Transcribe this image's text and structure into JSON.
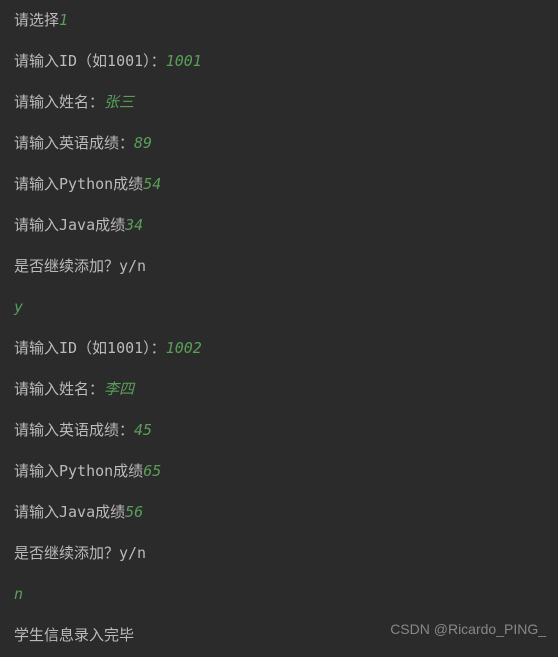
{
  "lines": [
    {
      "prompt": "请选择",
      "value": "1"
    },
    {
      "prompt": "请输入ID（如1001）：",
      "value": "1001"
    },
    {
      "prompt": "请输入姓名：",
      "value": "张三"
    },
    {
      "prompt": "请输入英语成绩：",
      "value": "89"
    },
    {
      "prompt": "请输入Python成绩",
      "value": "54"
    },
    {
      "prompt": "请输入Java成绩",
      "value": "34"
    },
    {
      "prompt": "是否继续添加？y/n",
      "value": ""
    },
    {
      "prompt": "",
      "value": "y"
    },
    {
      "prompt": "请输入ID（如1001）：",
      "value": "1002"
    },
    {
      "prompt": "请输入姓名：",
      "value": "李四"
    },
    {
      "prompt": "请输入英语成绩：",
      "value": "45"
    },
    {
      "prompt": "请输入Python成绩",
      "value": "65"
    },
    {
      "prompt": "请输入Java成绩",
      "value": "56"
    },
    {
      "prompt": "是否继续添加？y/n",
      "value": ""
    },
    {
      "prompt": "",
      "value": "n"
    },
    {
      "prompt": "学生信息录入完毕",
      "value": ""
    }
  ],
  "watermark": "CSDN @Ricardo_PING_"
}
